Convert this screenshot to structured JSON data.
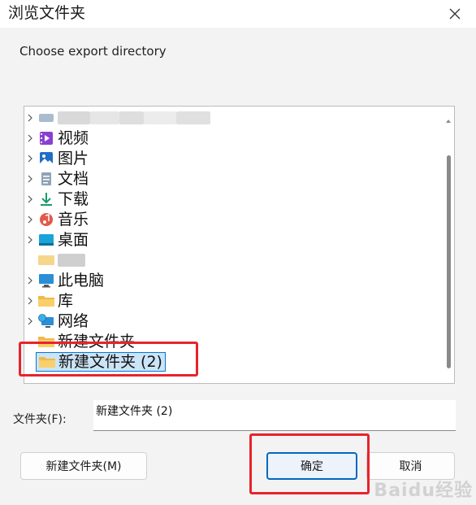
{
  "window": {
    "title": "浏览文件夹",
    "close_icon": "close-icon"
  },
  "description": "Choose export directory",
  "tree": {
    "items": [
      {
        "label": "",
        "icon": "blurred-drive-icon",
        "blurred": true,
        "expandable": true
      },
      {
        "label": "视频",
        "icon": "video-icon",
        "expandable": true
      },
      {
        "label": "图片",
        "icon": "pictures-icon",
        "expandable": true
      },
      {
        "label": "文档",
        "icon": "documents-icon",
        "expandable": true
      },
      {
        "label": "下载",
        "icon": "download-icon",
        "expandable": true
      },
      {
        "label": "音乐",
        "icon": "music-icon",
        "expandable": true
      },
      {
        "label": "桌面",
        "icon": "desktop-icon",
        "expandable": true
      },
      {
        "label": "",
        "icon": "blurred-folder-icon",
        "blurred": true,
        "expandable": false
      },
      {
        "label": "此电脑",
        "icon": "computer-icon",
        "expandable": true
      },
      {
        "label": "库",
        "icon": "library-folder-icon",
        "expandable": true
      },
      {
        "label": "网络",
        "icon": "network-icon",
        "expandable": true
      },
      {
        "label": "新建文件夹",
        "icon": "folder-icon",
        "expandable": false
      },
      {
        "label": "新建文件夹 (2)",
        "icon": "folder-icon",
        "expandable": false,
        "selected": true
      }
    ]
  },
  "folder_field": {
    "label": "文件夹(F):",
    "value": "新建文件夹 (2)"
  },
  "buttons": {
    "new_folder": "新建文件夹(M)",
    "ok": "确定",
    "cancel": "取消"
  },
  "colors": {
    "accent": "#0067c0",
    "selection": "#cce4f7",
    "highlight_annotation": "#e8232c"
  },
  "watermark": "Baidu经验"
}
